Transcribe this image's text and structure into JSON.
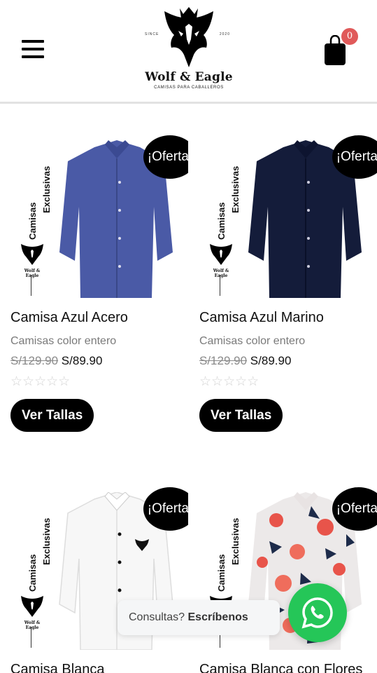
{
  "header": {
    "menu_icon": "hamburger-menu-icon",
    "logo": {
      "name": "Wolf & Eagle",
      "tagline": "CAMISAS PARA CABALLEROS",
      "since": "SINCE",
      "year": "2020"
    },
    "cart": {
      "icon": "shopping-bag-icon",
      "count": "0"
    }
  },
  "image_label": {
    "line1": "Camisas",
    "line2": "Exclusivas",
    "mini_logo": "Wolf & Eagle"
  },
  "products": [
    {
      "title": "Camisa Azul Acero",
      "category": "Camisas color entero",
      "old_price": "S/129.90",
      "new_price": "S/89.90",
      "badge": "¡Oferta!",
      "rating": 0,
      "button": "Ver Tallas",
      "shirt_color": "#4a5aa6"
    },
    {
      "title": "Camisa Azul Marino",
      "category": "Camisas color entero",
      "old_price": "S/129.90",
      "new_price": "S/89.90",
      "badge": "¡Oferta!",
      "rating": 0,
      "button": "Ver Tallas",
      "shirt_color": "#141c3a"
    },
    {
      "title": "Camisa Blanca",
      "badge": "¡Oferta!",
      "shirt_color": "#f5f5f5"
    },
    {
      "title": "Camisa Blanca con Flores",
      "badge": "¡Oferta!",
      "shirt_color": "#e9e6e6"
    }
  ],
  "chat": {
    "prefix": "Consultas?",
    "bold": "Escríbenos",
    "icon": "whatsapp-icon",
    "color": "#25c658"
  }
}
